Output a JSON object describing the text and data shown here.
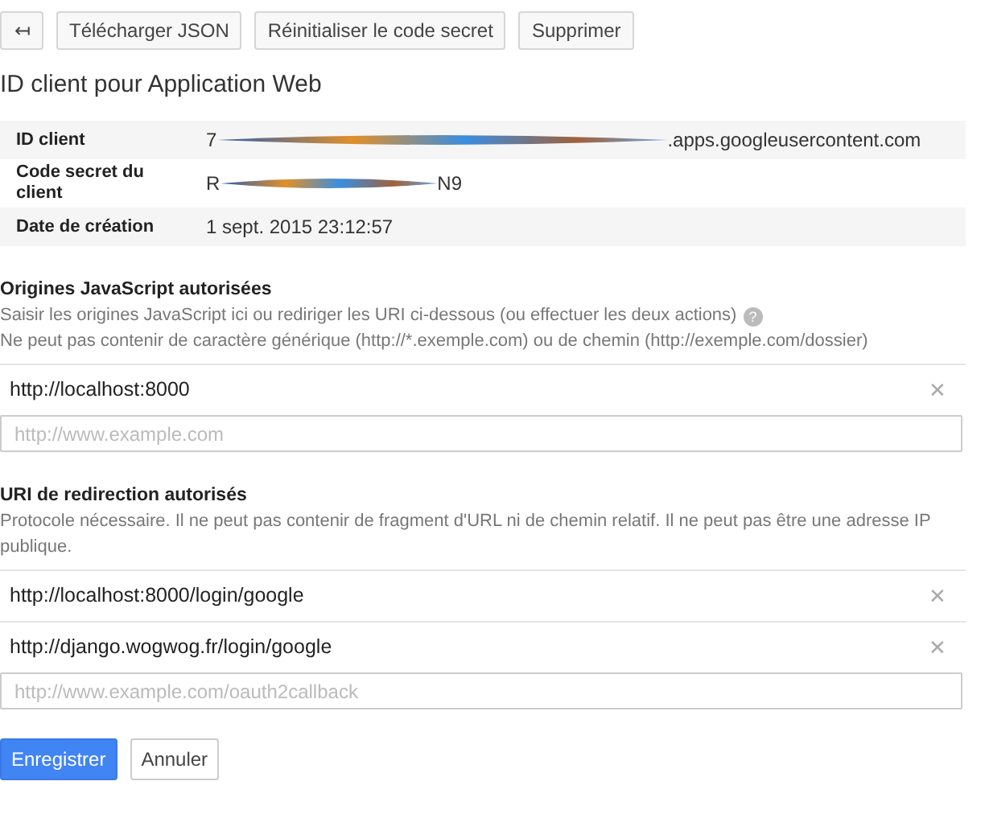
{
  "toolbar": {
    "back_icon": "↤",
    "buttons": [
      "Télécharger JSON",
      "Réinitialiser le code secret",
      "Supprimer"
    ]
  },
  "title": "ID client pour Application Web",
  "details": [
    {
      "label": "ID client",
      "prefix": "7",
      "redacted": true,
      "suffix": ".apps.googleusercontent.com"
    },
    {
      "label": "Code secret du client",
      "prefix": "R",
      "redacted": true,
      "suffix": "N9"
    },
    {
      "label": "Date de création",
      "prefix": "1 sept. 2015 23:12:57",
      "redacted": false
    }
  ],
  "sections": [
    {
      "heading": "Origines JavaScript autorisées",
      "help": [
        "Saisir les origines JavaScript ici ou rediriger les URI ci-dessous (ou effectuer les deux actions)",
        "Ne peut pas contenir de caractère générique (http://*.exemple.com) ou de chemin (http://exemple.com/dossier)"
      ],
      "help_icon": "?",
      "entries": [
        {
          "url": "http://localhost:8000",
          "remove": "✕"
        }
      ],
      "placeholder": "http://www.example.com"
    },
    {
      "heading": "URI de redirection autorisés",
      "help": [
        "Protocole nécessaire. Il ne peut pas contenir de fragment d'URL ni de chemin relatif. Il ne peut pas être une adresse IP publique."
      ],
      "entries": [
        {
          "url": "http://localhost:8000/login/google",
          "remove": "✕"
        },
        {
          "url": "http://django.wogwog.fr/login/google",
          "remove": "✕"
        }
      ],
      "placeholder": "http://www.example.com/oauth2callback"
    }
  ],
  "actions": [
    {
      "label": "Enregistrer",
      "primary": true
    },
    {
      "label": "Annuler",
      "primary": false
    }
  ]
}
